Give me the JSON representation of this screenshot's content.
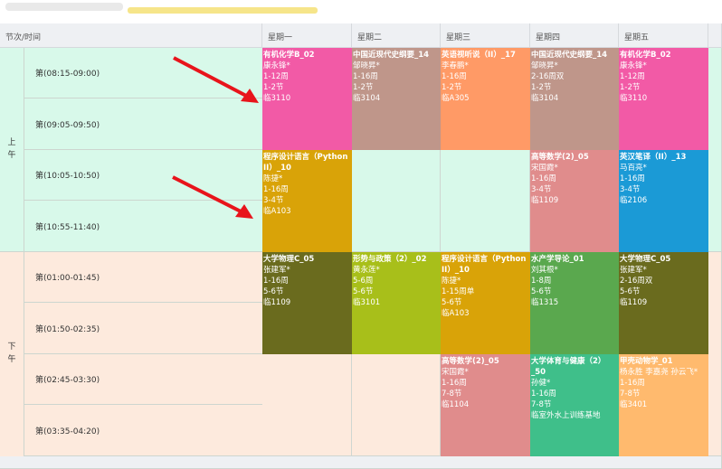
{
  "header": {
    "corner": "节次/时间",
    "days": [
      "星期一",
      "星期二",
      "星期三",
      "星期四",
      "星期五"
    ]
  },
  "periods": {
    "am": "上午",
    "pm": "下午"
  },
  "slots": [
    "第(08:15-09:00)",
    "第(09:05-09:50)",
    "第(10:05-10:50)",
    "第(10:55-11:40)",
    "第(01:00-01:45)",
    "第(01:50-02:35)",
    "第(02:45-03:30)",
    "第(03:35-04:20)"
  ],
  "courses": [
    {
      "name": "有机化学B_02",
      "teacher": "康永锋*",
      "weeks": "1-12周",
      "section": "1-2节",
      "room": "临3110",
      "color": "#f25aa6"
    },
    {
      "name": "中国近现代史纲要_14",
      "teacher": "邹晓昇*",
      "weeks": "1-16周",
      "section": "1-2节",
      "room": "临3104",
      "color": "#bf968a"
    },
    {
      "name": "英语视听说（II）_17",
      "teacher": "李春鹏*",
      "weeks": "1-16周",
      "section": "1-2节",
      "room": "临A305",
      "color": "#ff9a66"
    },
    {
      "name": "中国近现代史纲要_14",
      "teacher": "邹晓昇*",
      "weeks": "2-16周双",
      "section": "1-2节",
      "room": "临3104",
      "color": "#bf968a"
    },
    {
      "name": "有机化学B_02",
      "teacher": "康永锋*",
      "weeks": "1-12周",
      "section": "1-2节",
      "room": "临3110",
      "color": "#f25aa6"
    },
    {
      "name": "程序设计语言（Python II）_10",
      "teacher": "陈捷*",
      "weeks": "1-16周",
      "section": "3-4节",
      "room": "临A103",
      "color": "#d9a308"
    },
    {
      "name": "高等数学(2)_05",
      "teacher": "宋国霞*",
      "weeks": "1-16周",
      "section": "3-4节",
      "room": "临1109",
      "color": "#e08c8c"
    },
    {
      "name": "英汉笔译（II）_13",
      "teacher": "马百亮*",
      "weeks": "1-16周",
      "section": "3-4节",
      "room": "临2106",
      "color": "#1b9ad6"
    },
    {
      "name": "大学物理C_05",
      "teacher": "张建军*",
      "weeks": "1-16周",
      "section": "5-6节",
      "room": "临1109",
      "color": "#6a6b1e"
    },
    {
      "name": "形势与政策（2）_02",
      "teacher": "黄永莲*",
      "weeks": "5-6周",
      "section": "5-6节",
      "room": "临3101",
      "color": "#a8bf1a"
    },
    {
      "name": "程序设计语言（Python II）_10",
      "teacher": "陈捷*",
      "weeks": "1-15周单",
      "section": "5-6节",
      "room": "临A103",
      "color": "#d9a308"
    },
    {
      "name": "水产学导论_01",
      "teacher": "刘其根*",
      "weeks": "1-8周",
      "section": "5-6节",
      "room": "临1315",
      "color": "#5aa84e"
    },
    {
      "name": "大学物理C_05",
      "teacher": "张建军*",
      "weeks": "2-16周双",
      "section": "5-6节",
      "room": "临1109",
      "color": "#6a6b1e"
    },
    {
      "name": "高等数学(2)_05",
      "teacher": "宋国霞*",
      "weeks": "1-16周",
      "section": "7-8节",
      "room": "临1104",
      "color": "#e08c8c"
    },
    {
      "name": "大学体育与健康（2）_50",
      "teacher": "孙健*",
      "weeks": "1-16周",
      "section": "7-8节",
      "room": "临室外水上训练基地",
      "color": "#3fbf8a"
    },
    {
      "name": "甲壳动物学_01",
      "teacher": "杨永胜 李嘉尧 孙云飞*",
      "weeks": "1-16周",
      "section": "7-8节",
      "room": "临3401",
      "color": "#ffba6e"
    }
  ]
}
